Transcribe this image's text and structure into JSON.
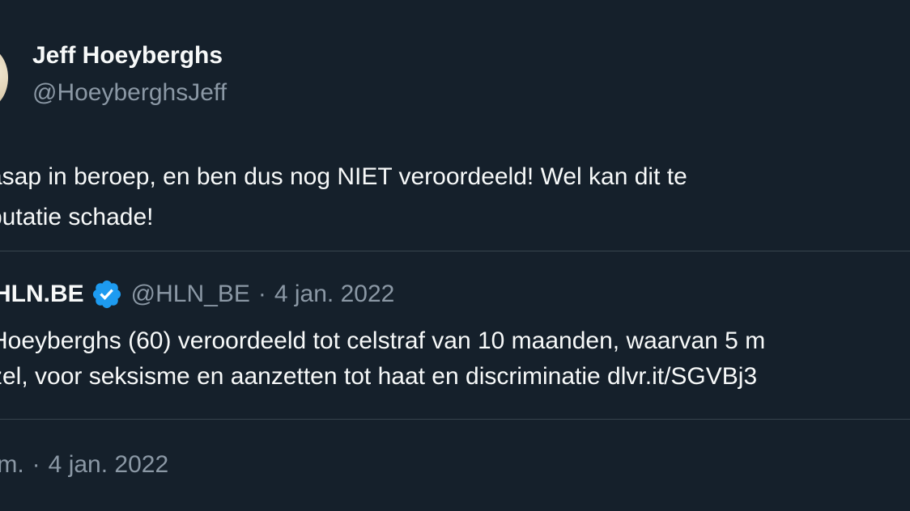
{
  "author": {
    "name": "Jeff Hoeyberghs",
    "handle": "@HoeyberghsJeff"
  },
  "tweet": {
    "line1": "asap in beroep, en ben dus nog NIET veroordeeld! Wel kan dit te",
    "line2": "putatie schade!"
  },
  "quoted": {
    "name": "HLN.BE",
    "verified_icon": "verified-badge-icon",
    "handle": "@HLN_BE",
    "separator": "·",
    "date": "4 jan. 2022",
    "line1": "Hoeyberghs (60) veroordeeld tot celstraf van 10 maanden, waarvan 5 m",
    "line2": "zel, voor seksisme en aanzetten tot haat en discriminatie dlvr.it/SGVBj3"
  },
  "meta": {
    "time": ".m.",
    "separator": "·",
    "date": "4 jan. 2022"
  },
  "colors": {
    "background": "#15202b",
    "text": "#f7f9f9",
    "secondary": "#8b98a5",
    "divider": "#38444d",
    "verified": "#1d9bf0"
  }
}
